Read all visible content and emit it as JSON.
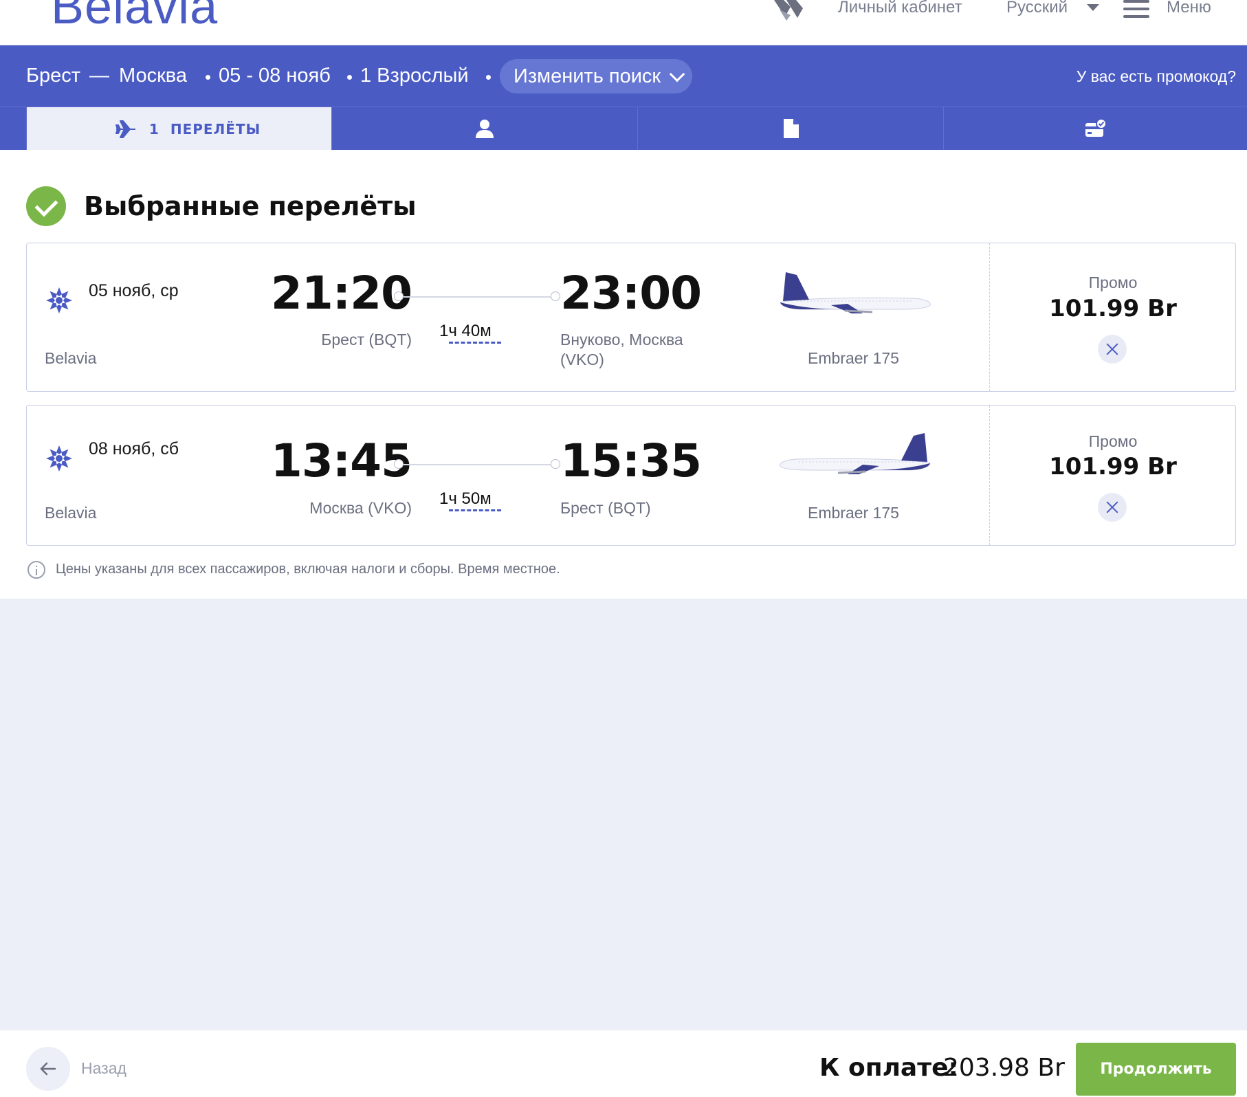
{
  "header": {
    "logo": "Belavia",
    "account_label": "Личный кабинет",
    "language_label": "Русский",
    "menu_label": "Меню"
  },
  "search": {
    "from": "Брест",
    "dash": "—",
    "to": "Москва",
    "dates": "05 - 08 нояб",
    "passengers": "1 Взрослый",
    "change_button": "Изменить поиск",
    "promo_link": "У вас есть промокод?"
  },
  "steps": [
    {
      "number": "1",
      "label": "ПЕРЕЛЁТЫ",
      "icon": "plane-icon",
      "active": true
    },
    {
      "icon": "passenger-icon",
      "active": false
    },
    {
      "icon": "document-icon",
      "active": false
    },
    {
      "icon": "payment-check-icon",
      "active": false
    }
  ],
  "main": {
    "title": "Выбранные перелёты",
    "note": "Цены указаны для всех пассажиров, включая налоги и сборы. Время местное."
  },
  "flights": [
    {
      "date": "05 нояб, ср",
      "airline": "Belavia",
      "departure_time": "21:20",
      "departure_station": "Брест (BQT)",
      "duration": "1ч 40м",
      "arrival_time": "23:00",
      "arrival_station": "Внуково, Москва (VKO)",
      "aircraft": "Embraer 175",
      "fare": "Промо",
      "price": "101.99 Br"
    },
    {
      "date": "08 нояб, сб",
      "airline": "Belavia",
      "departure_time": "13:45",
      "departure_station": "Москва (VKO)",
      "duration": "1ч 50м",
      "arrival_time": "15:35",
      "arrival_station": "Брест (BQT)",
      "aircraft": "Embraer 175",
      "fare": "Промо",
      "price": "101.99 Br"
    }
  ],
  "footer": {
    "back_label": "Назад",
    "total_label": "К оплате:",
    "total_value": "203.98 Br",
    "continue_label": "Продолжить"
  },
  "colors": {
    "brand": "#4a5bc4",
    "accent_green": "#7ab648",
    "background_grey": "#eceff8"
  }
}
